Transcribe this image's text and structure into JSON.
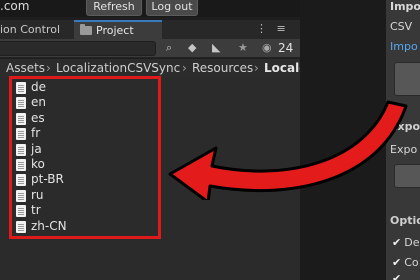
{
  "topbar": {
    "account_text": ".com",
    "refresh_label": "Refresh",
    "logout_label": "Log out"
  },
  "tabs": {
    "left_label": "ion Control",
    "project_label": "Project",
    "icons_text": "⋮ ≡"
  },
  "toolbar": {
    "hidden_count": "24",
    "icons": [
      "scene-search-icon",
      "palette-icon",
      "tag-icon",
      "star-icon",
      "eye-icon"
    ]
  },
  "breadcrumb": [
    "Assets",
    "LocalizationCSVSync",
    "Resources",
    "Locale"
  ],
  "files": [
    "de",
    "en",
    "es",
    "fr",
    "ja",
    "ko",
    "pt-BR",
    "ru",
    "tr",
    "zh-CN"
  ],
  "inspector": {
    "section1_title": "Impo",
    "csv_label": "CSV",
    "import_link": "Impo",
    "section2_title": "Expo",
    "export_label": "Expo",
    "options_title": "Optio",
    "checks": [
      "De",
      "Co",
      ""
    ]
  },
  "colors": {
    "highlight": "#e01a1a",
    "accent": "#3a79bb",
    "link": "#58a6f0"
  }
}
